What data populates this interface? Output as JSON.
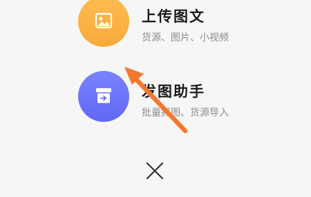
{
  "menu": {
    "upload": {
      "title": "上传图文",
      "subtitle": "货源、图片、小视频",
      "icon": "image-icon",
      "color": "#f8ac3e"
    },
    "assistant": {
      "title": "发图助手",
      "subtitle": "批量抓图、货源导入",
      "icon": "import-box-icon",
      "color": "#676df7"
    }
  },
  "close": {
    "icon": "close-icon"
  },
  "annotation": {
    "icon": "pointer-arrow-icon",
    "color": "#f5772e"
  }
}
